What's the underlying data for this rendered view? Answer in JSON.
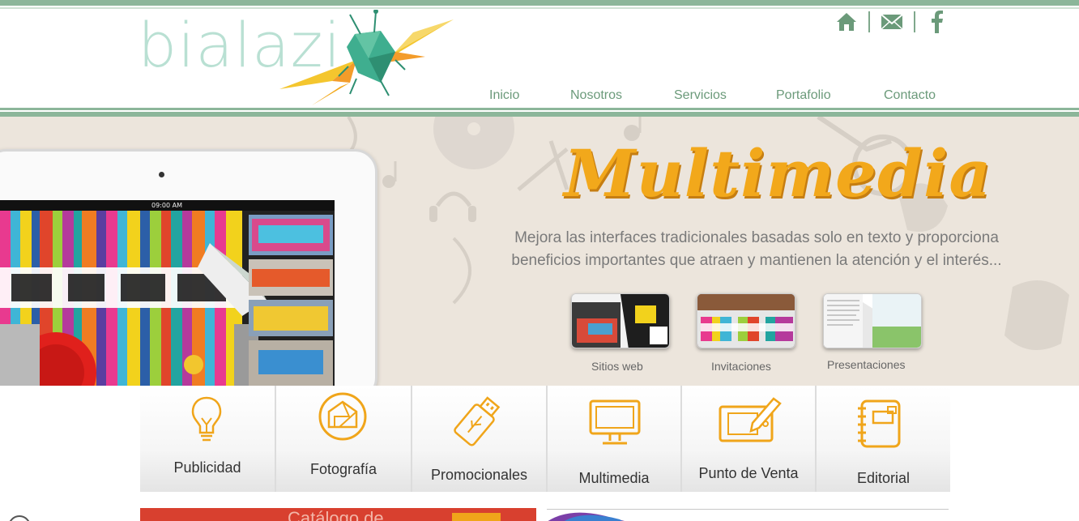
{
  "header": {
    "logo_text": "bialazi",
    "icons": [
      "home-icon",
      "mail-icon",
      "facebook-icon"
    ],
    "nav": [
      {
        "label": "Inicio"
      },
      {
        "label": "Nosotros"
      },
      {
        "label": "Servicios"
      },
      {
        "label": "Portafolio"
      },
      {
        "label": "Contacto"
      }
    ]
  },
  "hero": {
    "title": "Multimedia",
    "description_line1": "Mejora las interfaces tradicionales basadas solo en texto y proporciona",
    "description_line2": "beneficios importantes que atraen y mantienen la atención y el interés...",
    "tablet_time": "09:00 AM",
    "thumbs": [
      {
        "label": "Sitios web"
      },
      {
        "label": "Invitaciones"
      },
      {
        "label": "Presentaciones"
      }
    ]
  },
  "services": [
    {
      "label": "Publicidad",
      "icon": "lightbulb-icon"
    },
    {
      "label": "Fotografía",
      "icon": "camera-aperture-icon"
    },
    {
      "label": "Promocionales",
      "icon": "usb-drive-icon"
    },
    {
      "label": "Multimedia",
      "icon": "monitor-icon"
    },
    {
      "label": "Punto de Venta",
      "icon": "tablet-pen-icon"
    },
    {
      "label": "Editorial",
      "icon": "notebook-icon"
    }
  ],
  "bottom": {
    "left_banner_text": "Catálogo de"
  },
  "colors": {
    "accent_green": "#8cb69a",
    "nav_text": "#6b9a7a",
    "logo_text": "#b9e0d3",
    "orange": "#f2a81b",
    "icon_orange": "#f0a51a"
  }
}
